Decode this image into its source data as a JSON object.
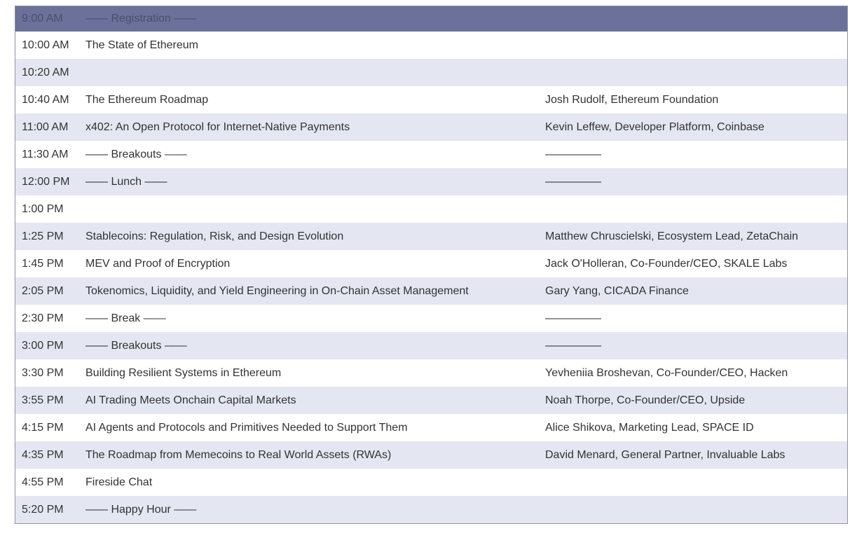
{
  "schedule": {
    "rows": [
      {
        "time": "9:00 AM",
        "session": "—— Registration ——",
        "speaker": ""
      },
      {
        "time": "10:00 AM",
        "session": "The State of Ethereum",
        "speaker": ""
      },
      {
        "time": "10:20 AM",
        "session": "",
        "speaker": ""
      },
      {
        "time": "10:40 AM",
        "session": "The Ethereum Roadmap",
        "speaker": "Josh Rudolf, Ethereum Foundation"
      },
      {
        "time": "11:00 AM",
        "session": "x402: An Open Protocol for Internet-Native Payments",
        "speaker": "Kevin Leffew, Developer Platform, Coinbase"
      },
      {
        "time": "11:30 AM",
        "session": "—— Breakouts ——",
        "speaker": "—————"
      },
      {
        "time": "12:00 PM",
        "session": "—— Lunch ——",
        "speaker": "—————"
      },
      {
        "time": "1:00 PM",
        "session": "",
        "speaker": ""
      },
      {
        "time": "1:25 PM",
        "session": "Stablecoins: Regulation, Risk, and Design Evolution",
        "speaker": "Matthew Chruscielski, Ecosystem Lead, ZetaChain"
      },
      {
        "time": "1:45 PM",
        "session": "MEV and Proof of Encryption",
        "speaker": "Jack O'Holleran, Co-Founder/CEO, SKALE Labs"
      },
      {
        "time": "2:05 PM",
        "session": "Tokenomics, Liquidity, and Yield Engineering in On-Chain Asset Management",
        "speaker": "Gary Yang, CICADA Finance"
      },
      {
        "time": "2:30 PM",
        "session": "—— Break ——",
        "speaker": "—————"
      },
      {
        "time": "3:00 PM",
        "session": "—— Breakouts ——",
        "speaker": "—————"
      },
      {
        "time": "3:30 PM",
        "session": "Building Resilient Systems in Ethereum",
        "speaker": "Yevheniia Broshevan, Co-Founder/CEO, Hacken"
      },
      {
        "time": "3:55 PM",
        "session": "AI Trading Meets Onchain Capital Markets",
        "speaker": "Noah Thorpe, Co-Founder/CEO, Upside"
      },
      {
        "time": "4:15 PM",
        "session": "AI Agents and Protocols and Primitives Needed to Support Them",
        "speaker": "Alice Shikova, Marketing Lead, SPACE ID"
      },
      {
        "time": "4:35 PM",
        "session": "The Roadmap from Memecoins to Real World Assets (RWAs)",
        "speaker": "David Menard, General Partner, Invaluable Labs"
      },
      {
        "time": "4:55 PM",
        "session": "Fireside Chat",
        "speaker": ""
      },
      {
        "time": "5:20 PM",
        "session": "—— Happy Hour ——",
        "speaker": ""
      }
    ]
  },
  "colors": {
    "header_bg": "#6b7199",
    "stripe_bg": "#e4e6f1",
    "text": "#333333"
  }
}
